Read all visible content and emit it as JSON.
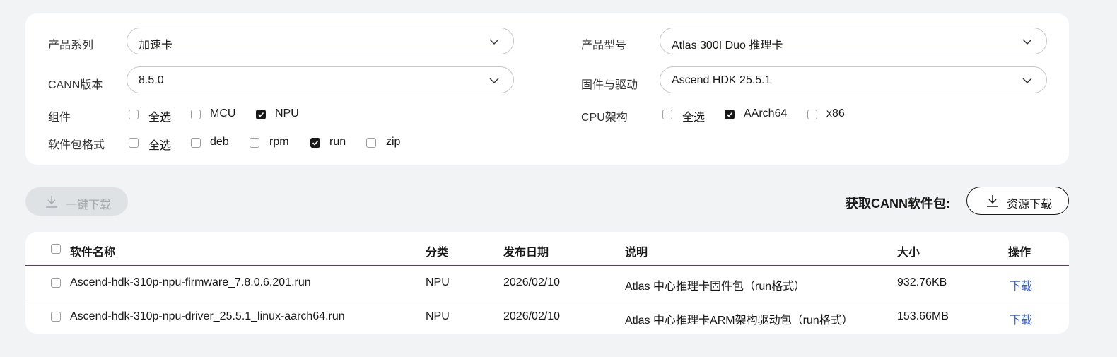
{
  "filters": {
    "product_series": {
      "label": "产品系列",
      "value": "加速卡"
    },
    "product_model": {
      "label": "产品型号",
      "value": "Atlas 300I Duo 推理卡"
    },
    "cann_version": {
      "label": "CANN版本",
      "value": "8.5.0"
    },
    "firmware_driver": {
      "label": "固件与驱动",
      "value": "Ascend HDK 25.5.1"
    },
    "components": {
      "label": "组件",
      "options": [
        {
          "label": "全选",
          "checked": false
        },
        {
          "label": "MCU",
          "checked": false
        },
        {
          "label": "NPU",
          "checked": true
        }
      ]
    },
    "cpu_arch": {
      "label": "CPU架构",
      "options": [
        {
          "label": "全选",
          "checked": false
        },
        {
          "label": "AArch64",
          "checked": true
        },
        {
          "label": "x86",
          "checked": false
        }
      ]
    },
    "package_format": {
      "label": "软件包格式",
      "options": [
        {
          "label": "全选",
          "checked": false
        },
        {
          "label": "deb",
          "checked": false
        },
        {
          "label": "rpm",
          "checked": false
        },
        {
          "label": "run",
          "checked": true
        },
        {
          "label": "zip",
          "checked": false
        }
      ]
    }
  },
  "actions": {
    "download_all_label": "一键下载",
    "get_cann_label": "获取CANN软件包:",
    "resource_download_label": "资源下载"
  },
  "table": {
    "headers": {
      "name": "软件名称",
      "category": "分类",
      "date": "发布日期",
      "description": "说明",
      "size": "大小",
      "action": "操作"
    },
    "rows": [
      {
        "name": "Ascend-hdk-310p-npu-firmware_7.8.0.6.201.run",
        "category": "NPU",
        "date": "2026/02/10",
        "description": "Atlas 中心推理卡固件包（run格式）",
        "size": "932.76KB",
        "action": "下载"
      },
      {
        "name": "Ascend-hdk-310p-npu-driver_25.5.1_linux-aarch64.run",
        "category": "NPU",
        "date": "2026/02/10",
        "description": "Atlas 中心推理卡ARM架构驱动包（run格式）",
        "size": "153.66MB",
        "action": "下载"
      }
    ]
  },
  "colors": {
    "page_bg": "#f1f3f5",
    "card_bg": "#ffffff",
    "header_divider": "#8a2b4b",
    "link": "#3a62e6",
    "disabled_button_bg": "#dfe2e5"
  }
}
